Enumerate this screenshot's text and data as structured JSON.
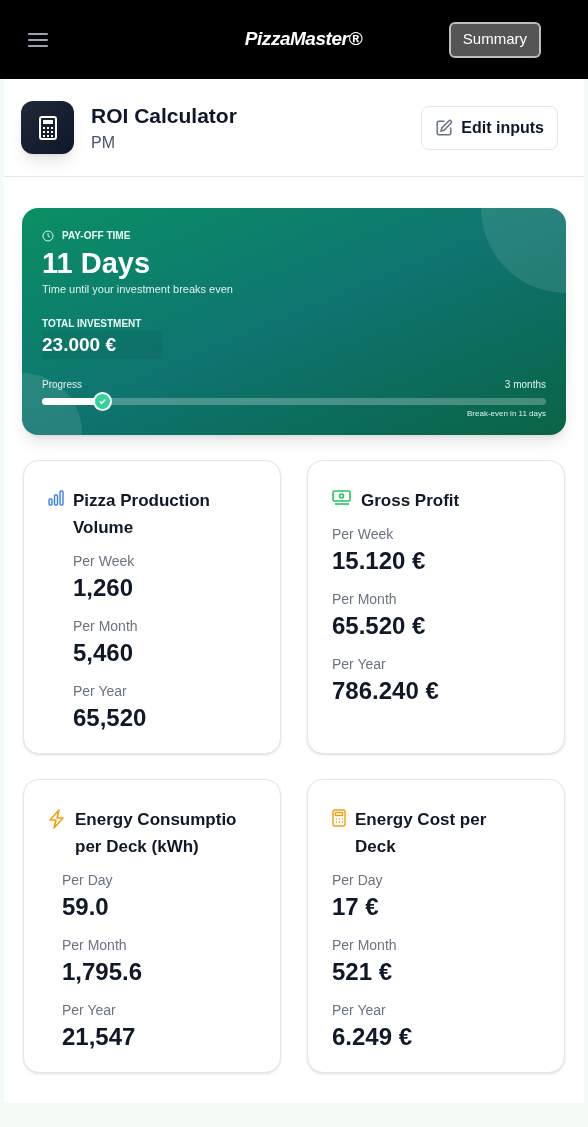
{
  "header": {
    "logo": "PizzaMaster®",
    "summary_button": "Summary"
  },
  "page": {
    "title": "ROI Calculator",
    "subtitle": "PM",
    "edit_button": "Edit inputs"
  },
  "payoff": {
    "label": "PAY-OFF TIME",
    "value": "11 Days",
    "caption": "Time until your investment breaks even",
    "investment_label": "TOTAL INVESTMENT",
    "investment_value": "23.000 €",
    "progress_label": "Progress",
    "progress_end": "3 months",
    "level": 0.12,
    "progress_note": "Break-even in 11 days"
  },
  "cards": [
    {
      "kind": "bars",
      "title_lines": [
        "Pizza Production",
        "Volume"
      ],
      "stats": [
        {
          "label": "Per Week",
          "value": "1,260"
        },
        {
          "label": "Per Month",
          "value": "5,460"
        },
        {
          "label": "Per Year",
          "value": "65,520"
        }
      ]
    },
    {
      "kind": "money",
      "title_lines": [
        "Gross Profit"
      ],
      "stats": [
        {
          "label": "Per Week",
          "value": "15.120 €"
        },
        {
          "label": "Per Month",
          "value": "65.520 €"
        },
        {
          "label": "Per Year",
          "value": "786.240 €"
        }
      ]
    },
    {
      "kind": "bolt",
      "title_lines": [
        "Energy Consumptio",
        "per Deck (kWh)"
      ],
      "stats": [
        {
          "label": "Per Day",
          "value": "59.0"
        },
        {
          "label": "Per Month",
          "value": "1,795.6"
        },
        {
          "label": "Per Year",
          "value": "21,547"
        }
      ]
    },
    {
      "kind": "calculator",
      "title_lines": [
        "Energy Cost per",
        "Deck"
      ],
      "stats": [
        {
          "label": "Per Day",
          "value": "17 €"
        },
        {
          "label": "Per Month",
          "value": "521 €"
        },
        {
          "label": "Per Year",
          "value": "6.249 €"
        }
      ]
    }
  ]
}
